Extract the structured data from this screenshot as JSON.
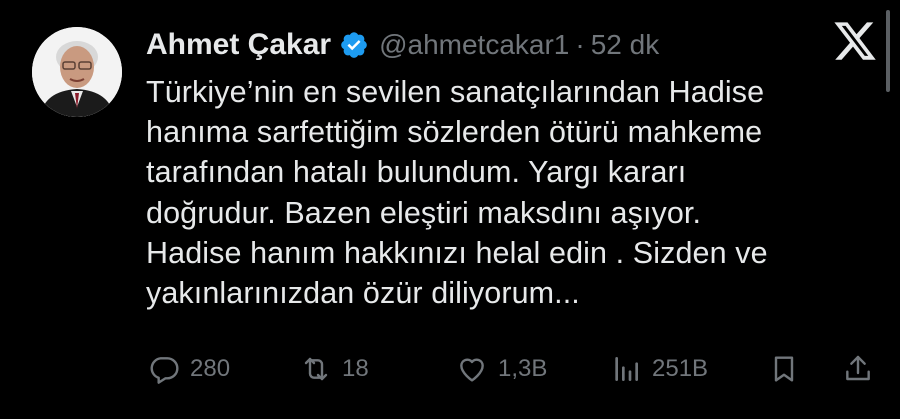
{
  "tweet": {
    "author_name": "Ahmet Çakar",
    "handle": "@ahmetcakar1",
    "separator": "·",
    "time": "52 dk",
    "text": "Türkiye’nin en sevilen sanatçılarından Hadise\nhanıma sarfettiğim sözlerden ötürü mahkeme\ntarafından hatalı bulundum. Yargı kararı\ndoğrudur. Bazen eleştiri maksdını aşıyor.\nHadise hanım hakkınızı helal edin . Sizden ve\nyakınlarınızdan özür diliyorum..."
  },
  "actions": {
    "replies": "280",
    "retweets": "18",
    "likes": "1,3B",
    "views": "251B"
  },
  "icons": {
    "verified": "verified-badge-icon",
    "logo": "x-logo-icon",
    "reply": "reply-icon",
    "retweet": "retweet-icon",
    "like": "heart-icon",
    "views": "views-chart-icon",
    "bookmark": "bookmark-icon",
    "share": "share-icon"
  },
  "colors": {
    "background": "#000000",
    "text": "#e7e9ea",
    "muted": "#71767b",
    "verified": "#1d9bf0"
  }
}
